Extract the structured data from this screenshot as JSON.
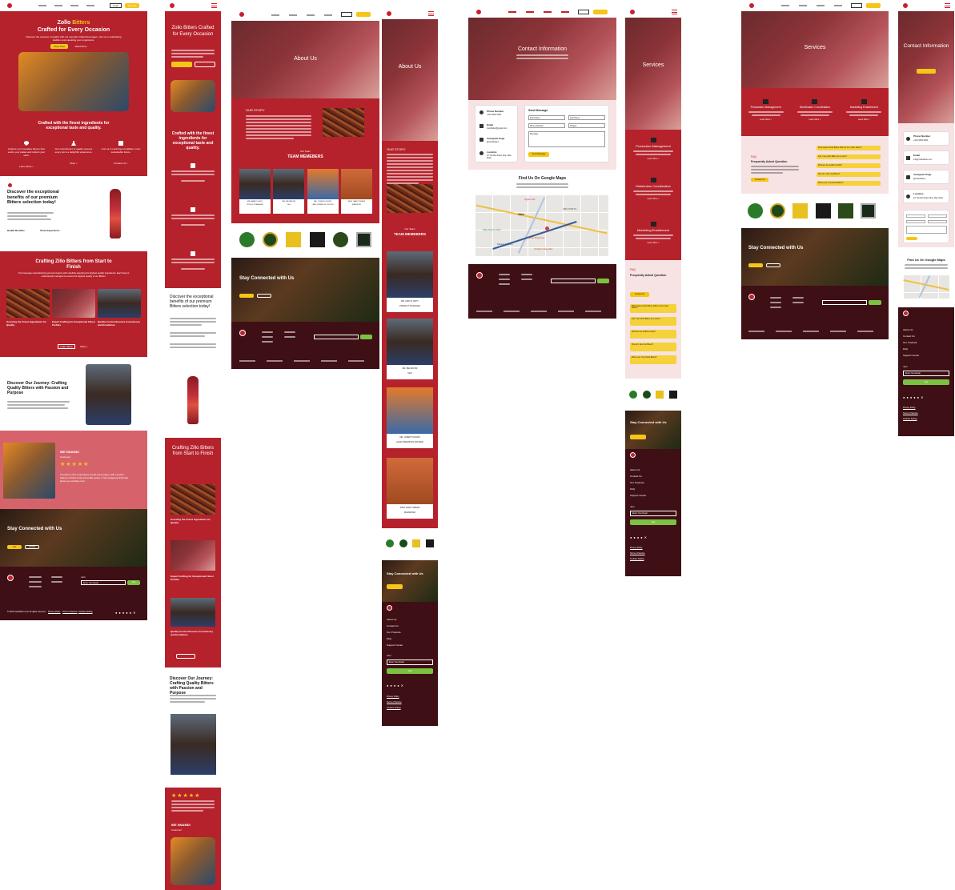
{
  "home": {
    "nav": {
      "login": "Login",
      "signup": "Sign Up"
    },
    "hero": {
      "title_a": "Zollo ",
      "title_b": "Bitters",
      "title_c": "Crafted for Every Occasion",
      "subtitle": "Discover the essence of quality with our expertly crafted beverages. Join us in celebrating tradition and elevating your experience.",
      "btn1": "Shop Now",
      "btn2": "Read More"
    },
    "features_title": "Crafted with the finest ingredients for exceptional taste and quality.",
    "features": [
      {
        "title": "Explore our innovative flavors that excite your palate and refresh your spirit.",
        "link": "Learn More >"
      },
      {
        "title": "Our commitment to quality ensures every sip is a delightful experience.",
        "link": "Shop >"
      },
      {
        "title": "Join us in nurturing a healthier, more sustainable future.",
        "link": "Contact Us >"
      }
    ],
    "discover": {
      "title": "Discover the exceptional benefits of our premium Bitters selection today!",
      "sub1": "Health Benefits",
      "sub2": "Taste Experience"
    },
    "crafting": {
      "title": "Crafting Zillo Bitters from Start to Finish",
      "sub": "Our beverage manufacturing process begins with carefully selecting the highest quality ingredients. Each step is meticulously managed to ensure the highest quality of our Bitters.",
      "cards": [
        "Sourcing the Finest Ingredients for Quality",
        "Expert Crafting for Exceptional Flavor Profiles",
        "Quality Control Ensures Consistency and Excellence"
      ],
      "btn1": "Learn More",
      "btn2": "Shop >"
    },
    "journey": {
      "title": "Discover Our Journey: Crafting Quality Bitters with Passion and Purpose"
    },
    "testimonial": {
      "name": "IBE NNAMDI",
      "role": "Customer",
      "stars": "★★★★★",
      "quote": "The flavor of the zoolo bitters is bold and complex, with a perfect balance of bitter herbs and subtle spices. It has a lingering finish that leaves you wanting more."
    },
    "stay": {
      "title": "Stay Connected with Us",
      "btn1": "Join",
      "btn2": "Contact"
    },
    "footer": {
      "join": "Join",
      "email_placeholder": "Enter Your Email",
      "send": "Join",
      "copyright": "© 2024 zoolobitters.com All rights reserved.",
      "links": [
        "Privacy Policy",
        "Terms of Service",
        "Cookies Setting"
      ]
    }
  },
  "mobile_home": {
    "title": "Zollo Bitters Crafted for Every Occasion",
    "features_title": "Crafted with the finest ingredients for exceptional taste and quality.",
    "discover": "Discover the exceptional benefits of our premium Bitters selection today!",
    "crafting": "Crafting Zillo Bitters from Start to Finish",
    "cards": [
      "Sourcing the Finest Ingredients for Quality",
      "Expert Crafting for Exceptional Flavor Profiles",
      "Quality Control Ensures Consistency and Excellence"
    ],
    "journey": "Discover Our Journey: Crafting Quality Bitters with Passion and Purpose",
    "name": "IBE NNAMDI",
    "role": "Customer",
    "stars": "★★★★★"
  },
  "about": {
    "hero": "About Us",
    "story": "OUR STORY",
    "team_small": "Our Team",
    "team": "TEAM MEMEBERS",
    "members": [
      {
        "name": "MR. AMAYO NOHY",
        "role": "PRODUCT MANAGER"
      },
      {
        "name": "MR. IBE MAYOR",
        "role": "CEO"
      },
      {
        "name": "MR. JOSEPH OKORO",
        "role": "LEAD OPERATION OFFICER"
      },
      {
        "name": "MISS. MARY NWEKE",
        "role": "MARKETER"
      }
    ],
    "stay": "Stay Connected with Us"
  },
  "mobile_about": {
    "hero": "About Us",
    "story": "OUR STORY",
    "team_small": "Our Team",
    "team": "TEAM MEMEBERS",
    "members": [
      {
        "name": "MR. AMAYO NOHY",
        "role": "PRODUCT MANAGER"
      },
      {
        "name": "MR. IBE MAYOR",
        "role": "CEO"
      },
      {
        "name": "MR. JOSEPH OKORO",
        "role": "LEAD OPERATION OFFICER"
      },
      {
        "name": "MISS. MARY NWEKE",
        "role": "MARKETER"
      }
    ],
    "stay": "Stay Connected with Us",
    "footer_links": [
      "About Us",
      "Contact Us",
      "Our Products",
      "FAQ",
      "Support Center"
    ],
    "join": "Join",
    "email_placeholder": "Enter Your Email",
    "send": "Join",
    "policy": [
      "Privacy Policy",
      "Terms of Service",
      "Cookies Setting"
    ]
  },
  "contact": {
    "hero": "Contact Information",
    "items": [
      {
        "label": "Phone Number",
        "value": "+234 0000 0000"
      },
      {
        "label": "Email",
        "value": "zoolobitter@gmail.com"
      },
      {
        "label": "Instagram Page",
        "value": "@zoolobitters"
      },
      {
        "label": "Location",
        "value": "12 Trombo Road, Aba, Abia State"
      }
    ],
    "form_title": "Send Message",
    "fields": [
      "First Name",
      "Last Name",
      "Phone Number",
      "Subject",
      "Message"
    ],
    "submit": "Send Message",
    "map_title": "Find Us On Google Maps",
    "map_labels": [
      "Ogbor Hill",
      "Aba",
      "ABA NORTH",
      "Abia Sports Club",
      "Market Square",
      "Jamie Brownies",
      "Chicken Republic"
    ]
  },
  "services": {
    "hero": "Services",
    "items": [
      "Production Management",
      "Distribution Coordination",
      "Marketing Enablement"
    ],
    "link": "Learn More >",
    "faq_small": "FAQ",
    "faq_title": "Frequently Asked Question",
    "faq_btn": "Contact Us",
    "questions": [
      "What makes Zoolo Bitters different from other bitters?",
      "Can I use Zoolo Bitters as a mixer?",
      "What are the health benefits?",
      "How do I store the Bitters?",
      "Where can I buy Zoolo Bitters?"
    ],
    "stay": "Stay Connected with Us"
  },
  "mobile_services": {
    "hero": "Services",
    "items": [
      "Production Management",
      "Distribution Coordination",
      "Marketing Enablement"
    ],
    "link": "Learn More >",
    "faq_small": "FAQ",
    "faq_title": "Frequently Asked Question",
    "faq_btn": "Contact Us",
    "questions": [
      "What makes Zoolo Bitters different from other bitters?",
      "Can I use Zoolo Bitters as a mixer?",
      "What are the health benefits?",
      "How do I store the Bitters?",
      "Where can I buy Zoolo Bitters?"
    ],
    "stay": "Stay Connected with Us",
    "footer_links": [
      "About Us",
      "Contact Us",
      "Our Products",
      "FAQ",
      "Support Center"
    ],
    "join": "Join",
    "email_placeholder": "Enter Your Email",
    "send": "Join",
    "policy": [
      "Privacy Policy",
      "Terms of Service",
      "Cookies Setting"
    ]
  },
  "mobile_contact": {
    "hero": "Contact Information",
    "items": [
      {
        "label": "Phone Number",
        "value": "+234 0000 0000"
      },
      {
        "label": "Email",
        "value": "info@zoolobitter.com"
      },
      {
        "label": "Instagram Page",
        "value": "@zoolobitters"
      },
      {
        "label": "Location",
        "value": "12 Trombo Road, Aba, Abia State"
      }
    ],
    "map_title": "Find Us On Google Maps",
    "footer_links": [
      "About Us",
      "Contact Us",
      "Our Products",
      "FAQ",
      "Support Center"
    ],
    "join": "Join",
    "email_placeholder": "Enter Your Email",
    "send": "Join",
    "policy": [
      "Privacy Policy",
      "Terms of Service",
      "Cookies Setting"
    ]
  },
  "colors": {
    "brand_red": "#b5222c",
    "dark": "#3e0f14",
    "yellow": "#f5c518",
    "green": "#7cc242",
    "pink": "#f7e3e4"
  }
}
